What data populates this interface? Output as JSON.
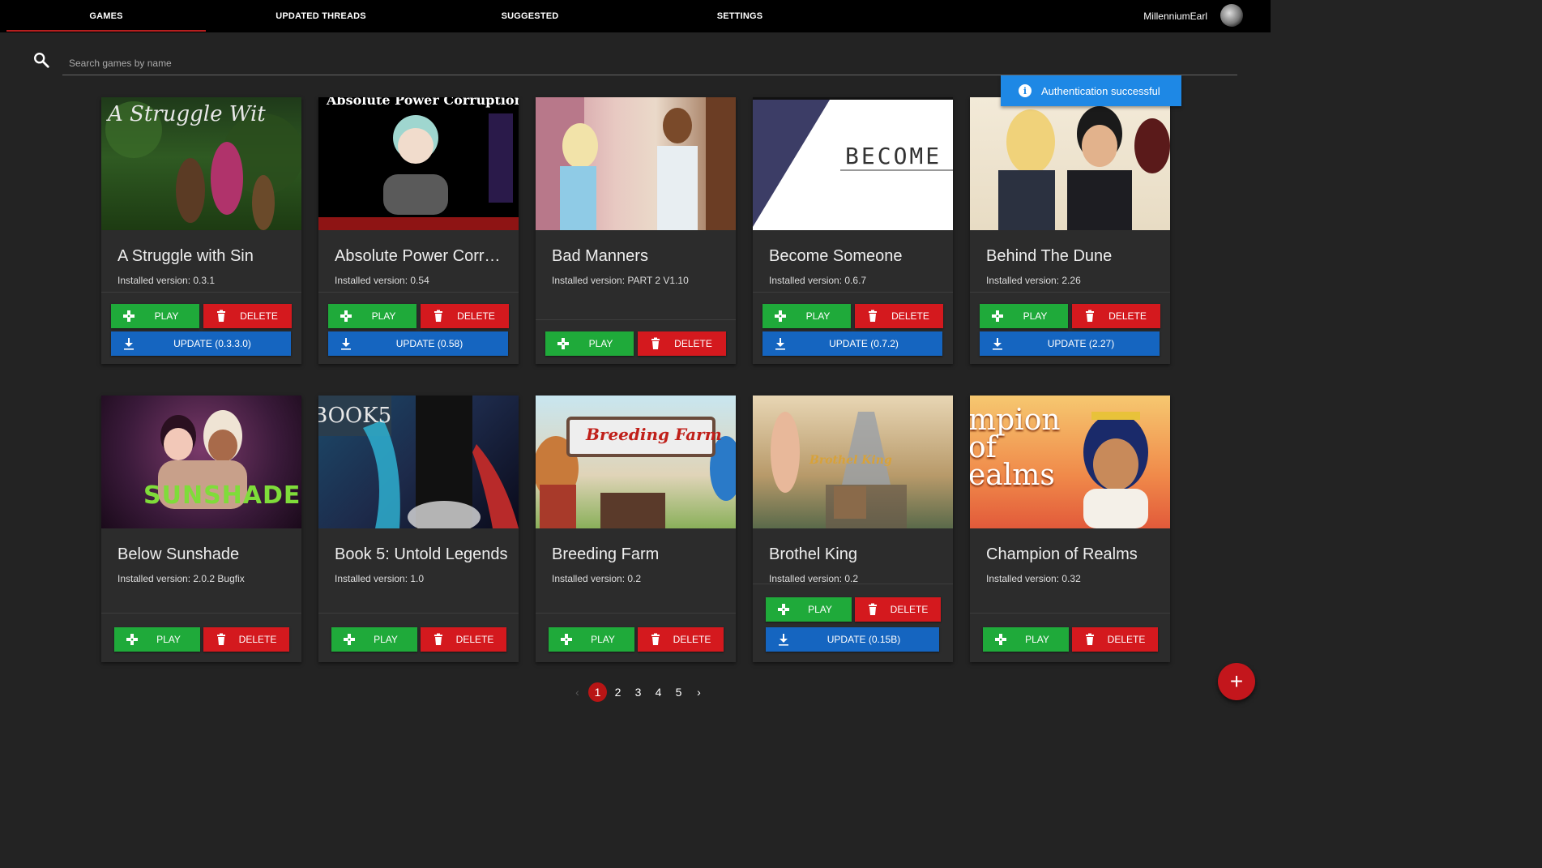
{
  "nav": {
    "tabs": [
      {
        "label": "GAMES"
      },
      {
        "label": "UPDATED THREADS"
      },
      {
        "label": "SUGGESTED"
      },
      {
        "label": "SETTINGS"
      }
    ],
    "username": "MillenniumEarl"
  },
  "search": {
    "placeholder": "Search games by name"
  },
  "toast": {
    "message": "Authentication successful"
  },
  "labels": {
    "play": "PLAY",
    "delete": "DELETE"
  },
  "games": [
    {
      "title": "A Struggle with Sin",
      "version": "Installed version: 0.3.1",
      "update": "UPDATE (0.3.3.0)",
      "thumb_text": "A Struggle Wit"
    },
    {
      "title": "Absolute Power Corruption",
      "version": "Installed version: 0.54",
      "update": "UPDATE (0.58)",
      "thumb_text": "Absolute Power Corruption"
    },
    {
      "title": "Bad Manners",
      "version": "Installed version: PART 2 V1.10",
      "update": null,
      "thumb_text": ""
    },
    {
      "title": "Become Someone",
      "version": "Installed version: 0.6.7",
      "update": "UPDATE (0.7.2)",
      "thumb_text": "BECOME"
    },
    {
      "title": "Behind The Dune",
      "version": "Installed version: 2.26",
      "update": "UPDATE (2.27)",
      "thumb_text": ""
    },
    {
      "title": "Below Sunshade",
      "version": "Installed version: 2.0.2 Bugfix",
      "update": null,
      "thumb_text": "SUNSHADE"
    },
    {
      "title": "Book 5: Untold Legends",
      "version": "Installed version: 1.0",
      "update": null,
      "thumb_text": "BOOK5"
    },
    {
      "title": "Breeding Farm",
      "version": "Installed version: 0.2",
      "update": null,
      "thumb_text": "Breeding Farm"
    },
    {
      "title": "Brothel King",
      "version": "Installed version: 0.2",
      "update": "UPDATE (0.15B)",
      "thumb_text": "Brothel King"
    },
    {
      "title": "Champion of Realms",
      "version": "Installed version: 0.32",
      "update": null,
      "thumb_text": "mpion of ealms"
    }
  ],
  "pagination": {
    "prev": "‹",
    "pages": [
      "1",
      "2",
      "3",
      "4",
      "5"
    ],
    "next": "›",
    "current": "1"
  },
  "fab": {
    "label": "+"
  },
  "colors": {
    "accent": "#b51f1f",
    "play": "#1faa3a",
    "delete": "#d4191e",
    "update": "#1565c0",
    "toast": "#1e88e5"
  }
}
